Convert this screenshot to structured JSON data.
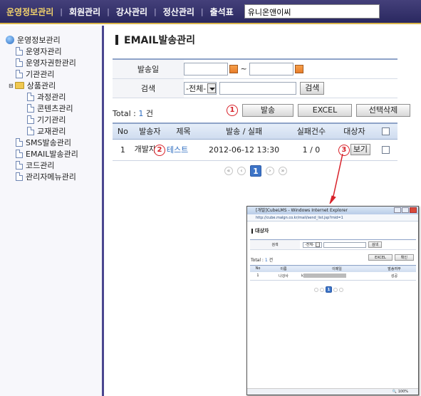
{
  "topnav": {
    "items": [
      "운영정보관리",
      "회원관리",
      "강사관리",
      "정산관리",
      "출석표"
    ],
    "separator": "|",
    "search_value": "유니온앤이씨"
  },
  "sidebar": {
    "root": "운영정보관리",
    "items": [
      "운영자관리",
      "운영자권한관리",
      "기관관리"
    ],
    "folder": "상품관리",
    "sub_items": [
      "과정관리",
      "콘텐츠관리",
      "기기관리",
      "교재관리"
    ],
    "items_after": [
      "SMS발송관리",
      "EMAIL발송관리",
      "코드관리",
      "관리자메뉴관리"
    ]
  },
  "page": {
    "title": "EMAIL발송관리"
  },
  "filter": {
    "date_label": "발송일",
    "date_sep": "~",
    "search_label": "검색",
    "select_value": "-전체-",
    "search_button": "검색"
  },
  "summary": {
    "total_label": "Total : ",
    "total_count": "1",
    "total_unit": " 건"
  },
  "actions": {
    "send": "발송",
    "excel": "EXCEL",
    "delete": "선택삭제"
  },
  "markers": [
    "1",
    "2",
    "3"
  ],
  "table": {
    "headers": [
      "No",
      "발송자",
      "제목",
      "발송 / 실패",
      "실패건수",
      "대상자"
    ],
    "row": {
      "no": "1",
      "sender": "개발자",
      "subject": "테스트",
      "date": "2012-06-12 13:30",
      "fail": "1 / 0",
      "view": "보기"
    }
  },
  "pager": {
    "first": "«",
    "prev": "‹",
    "current": "1",
    "next": "›",
    "last": "»"
  },
  "popup": {
    "window_title": "[개발]CubeLMS - Windows Internet Explorer",
    "address": "http://cube.malgn.co.kr/mail/send_list.jsp?mid=1",
    "heading": "대상자",
    "search_label": "검색",
    "select_value": "-전체-",
    "search_button": "검색",
    "total_label": "Total : ",
    "total_count": "1",
    "total_unit": " 건",
    "excel": "EXCEL",
    "confirm": "확인",
    "headers": [
      "No",
      "이름",
      "이메일",
      "발송여부"
    ],
    "row": {
      "no": "1",
      "name": "나강사",
      "email_prefix": "k",
      "status": "성공"
    },
    "page": "1",
    "zoom": "100%"
  },
  "colors": {
    "nav_bg": "#2a2860",
    "nav_active": "#f3d36b",
    "accent": "#3d74c7",
    "marker": "#d8222a"
  }
}
